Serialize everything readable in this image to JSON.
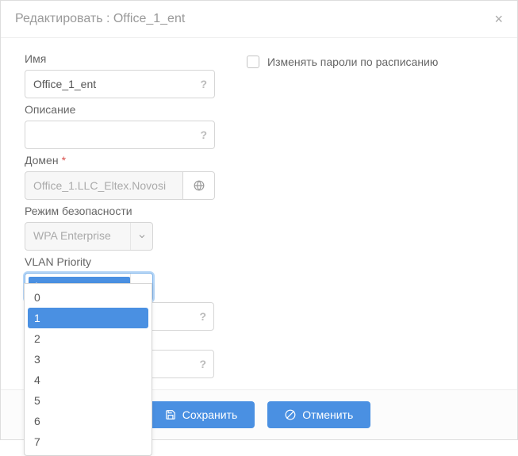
{
  "header": {
    "title": "Редактировать : Office_1_ent"
  },
  "fields": {
    "name": {
      "label": "Имя",
      "value": "Office_1_ent"
    },
    "description": {
      "label": "Описание",
      "value": ""
    },
    "domain": {
      "label": "Домен",
      "required": "*",
      "value": "Office_1.LLC_Eltex.Novosi"
    },
    "security": {
      "label": "Режим безопасности",
      "value": "WPA Enterprise"
    },
    "vlanPriority": {
      "label": "VLAN Priority",
      "value": "1"
    }
  },
  "dropdown": {
    "options": [
      "0",
      "1",
      "2",
      "3",
      "4",
      "5",
      "6",
      "7"
    ],
    "selected": "1"
  },
  "checkbox": {
    "label": "Изменять пароли по расписанию"
  },
  "buttons": {
    "save": "Сохранить",
    "cancel": "Отменить"
  }
}
